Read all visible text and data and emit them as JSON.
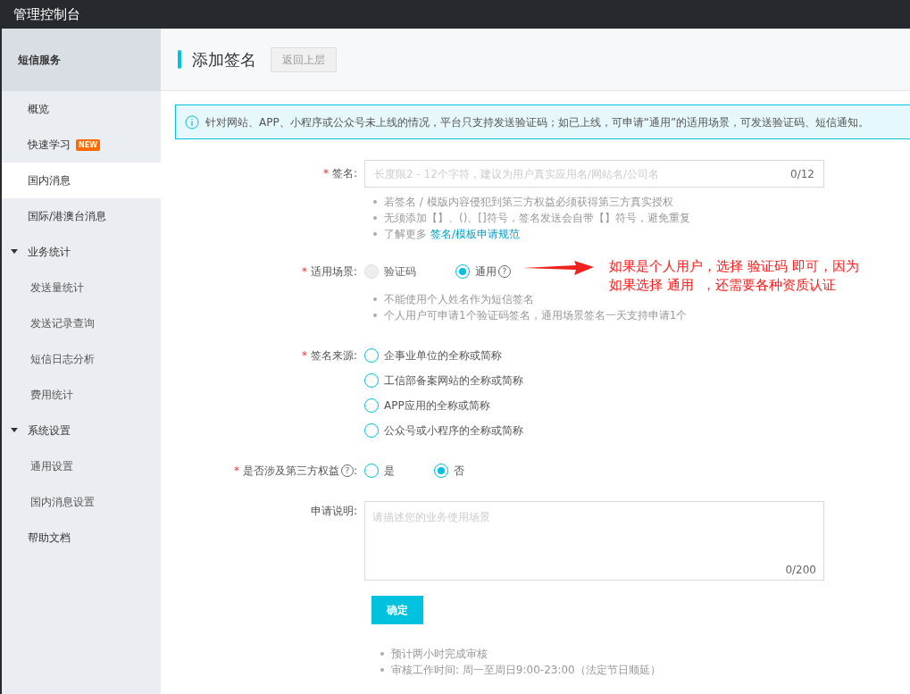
{
  "topbar": {
    "title": "管理控制台"
  },
  "sidebar": {
    "header": "短信服务",
    "items": [
      {
        "label": "概览",
        "selected": false
      },
      {
        "label": "快速学习",
        "badge": "NEW",
        "selected": false
      },
      {
        "label": "国内消息",
        "selected": true
      },
      {
        "label": "国际/港澳台消息",
        "selected": false
      },
      {
        "label": "业务统计",
        "selected": false,
        "expanded": true,
        "children": [
          {
            "label": "发送量统计",
            "selected": false
          },
          {
            "label": "发送记录查询",
            "selected": false
          },
          {
            "label": "短信日志分析",
            "selected": false
          },
          {
            "label": "费用统计",
            "selected": false
          }
        ]
      },
      {
        "label": "系统设置",
        "selected": false,
        "expanded": true,
        "children": [
          {
            "label": "通用设置",
            "selected": false
          },
          {
            "label": "国内消息设置",
            "selected": false
          }
        ]
      },
      {
        "label": "帮助文档",
        "selected": false
      }
    ]
  },
  "page": {
    "title": "添加签名",
    "back_button": "返回上层"
  },
  "notice": "针对网站、APP、小程序或公众号未上线的情况，平台只支持发送验证码；如已上线，可申请“通用”的适用场景，可发送验证码、短信通知。",
  "form": {
    "signature": {
      "label": "签名:",
      "required_mark": "*",
      "placeholder": "长度限2 - 12个字符，建议为用户真实应用名/网站名/公司名",
      "counter": "0/12",
      "hints": [
        {
          "text": "若签名 / 模版内容侵犯到第三方权益必须获得第三方真实授权"
        },
        {
          "text": "无须添加【】、()、[]符号，签名发送会自带【】符号，避免重复"
        },
        {
          "text": "了解更多",
          "link": "签名/模板申请规范"
        }
      ]
    },
    "scene": {
      "label": "适用场景:",
      "required_mark": "*",
      "options": [
        {
          "label": "验证码",
          "selected": false,
          "disabled": true
        },
        {
          "label": "通用",
          "selected": true,
          "disabled": false,
          "help_mark": "?"
        }
      ],
      "hints": [
        "不能使用个人姓名作为短信签名",
        "个人用户可申请1个验证码签名，通用场景签名一天支持申请1个"
      ]
    },
    "source": {
      "label": "签名来源:",
      "required_mark": "*",
      "options": [
        {
          "label": "企事业单位的全称或简称",
          "selected": false
        },
        {
          "label": "工信部备案网站的全称或简称",
          "selected": false
        },
        {
          "label": "APP应用的全称或简称",
          "selected": false
        },
        {
          "label": "公众号或小程序的全称或简称",
          "selected": false
        }
      ]
    },
    "third_party": {
      "label": "是否涉及第三方权益",
      "required_mark": "*",
      "help_mark": "?",
      "label_suffix": ":",
      "options": [
        {
          "label": "是",
          "selected": false
        },
        {
          "label": "否",
          "selected": true
        }
      ]
    },
    "description": {
      "label": "申请说明:",
      "placeholder": "请描述您的业务使用场景",
      "counter": "0/200"
    },
    "submit": "确定",
    "footer_hints": [
      "预计两小时完成审核",
      "审核工作时间: 周一至周日9:00-23:00（法定节日顺延）"
    ]
  },
  "annotation": {
    "lines": [
      "如果是个人用户，选择 验证码 即可，因为",
      "如果选择 通用  ，还需要各种资质认证"
    ]
  }
}
